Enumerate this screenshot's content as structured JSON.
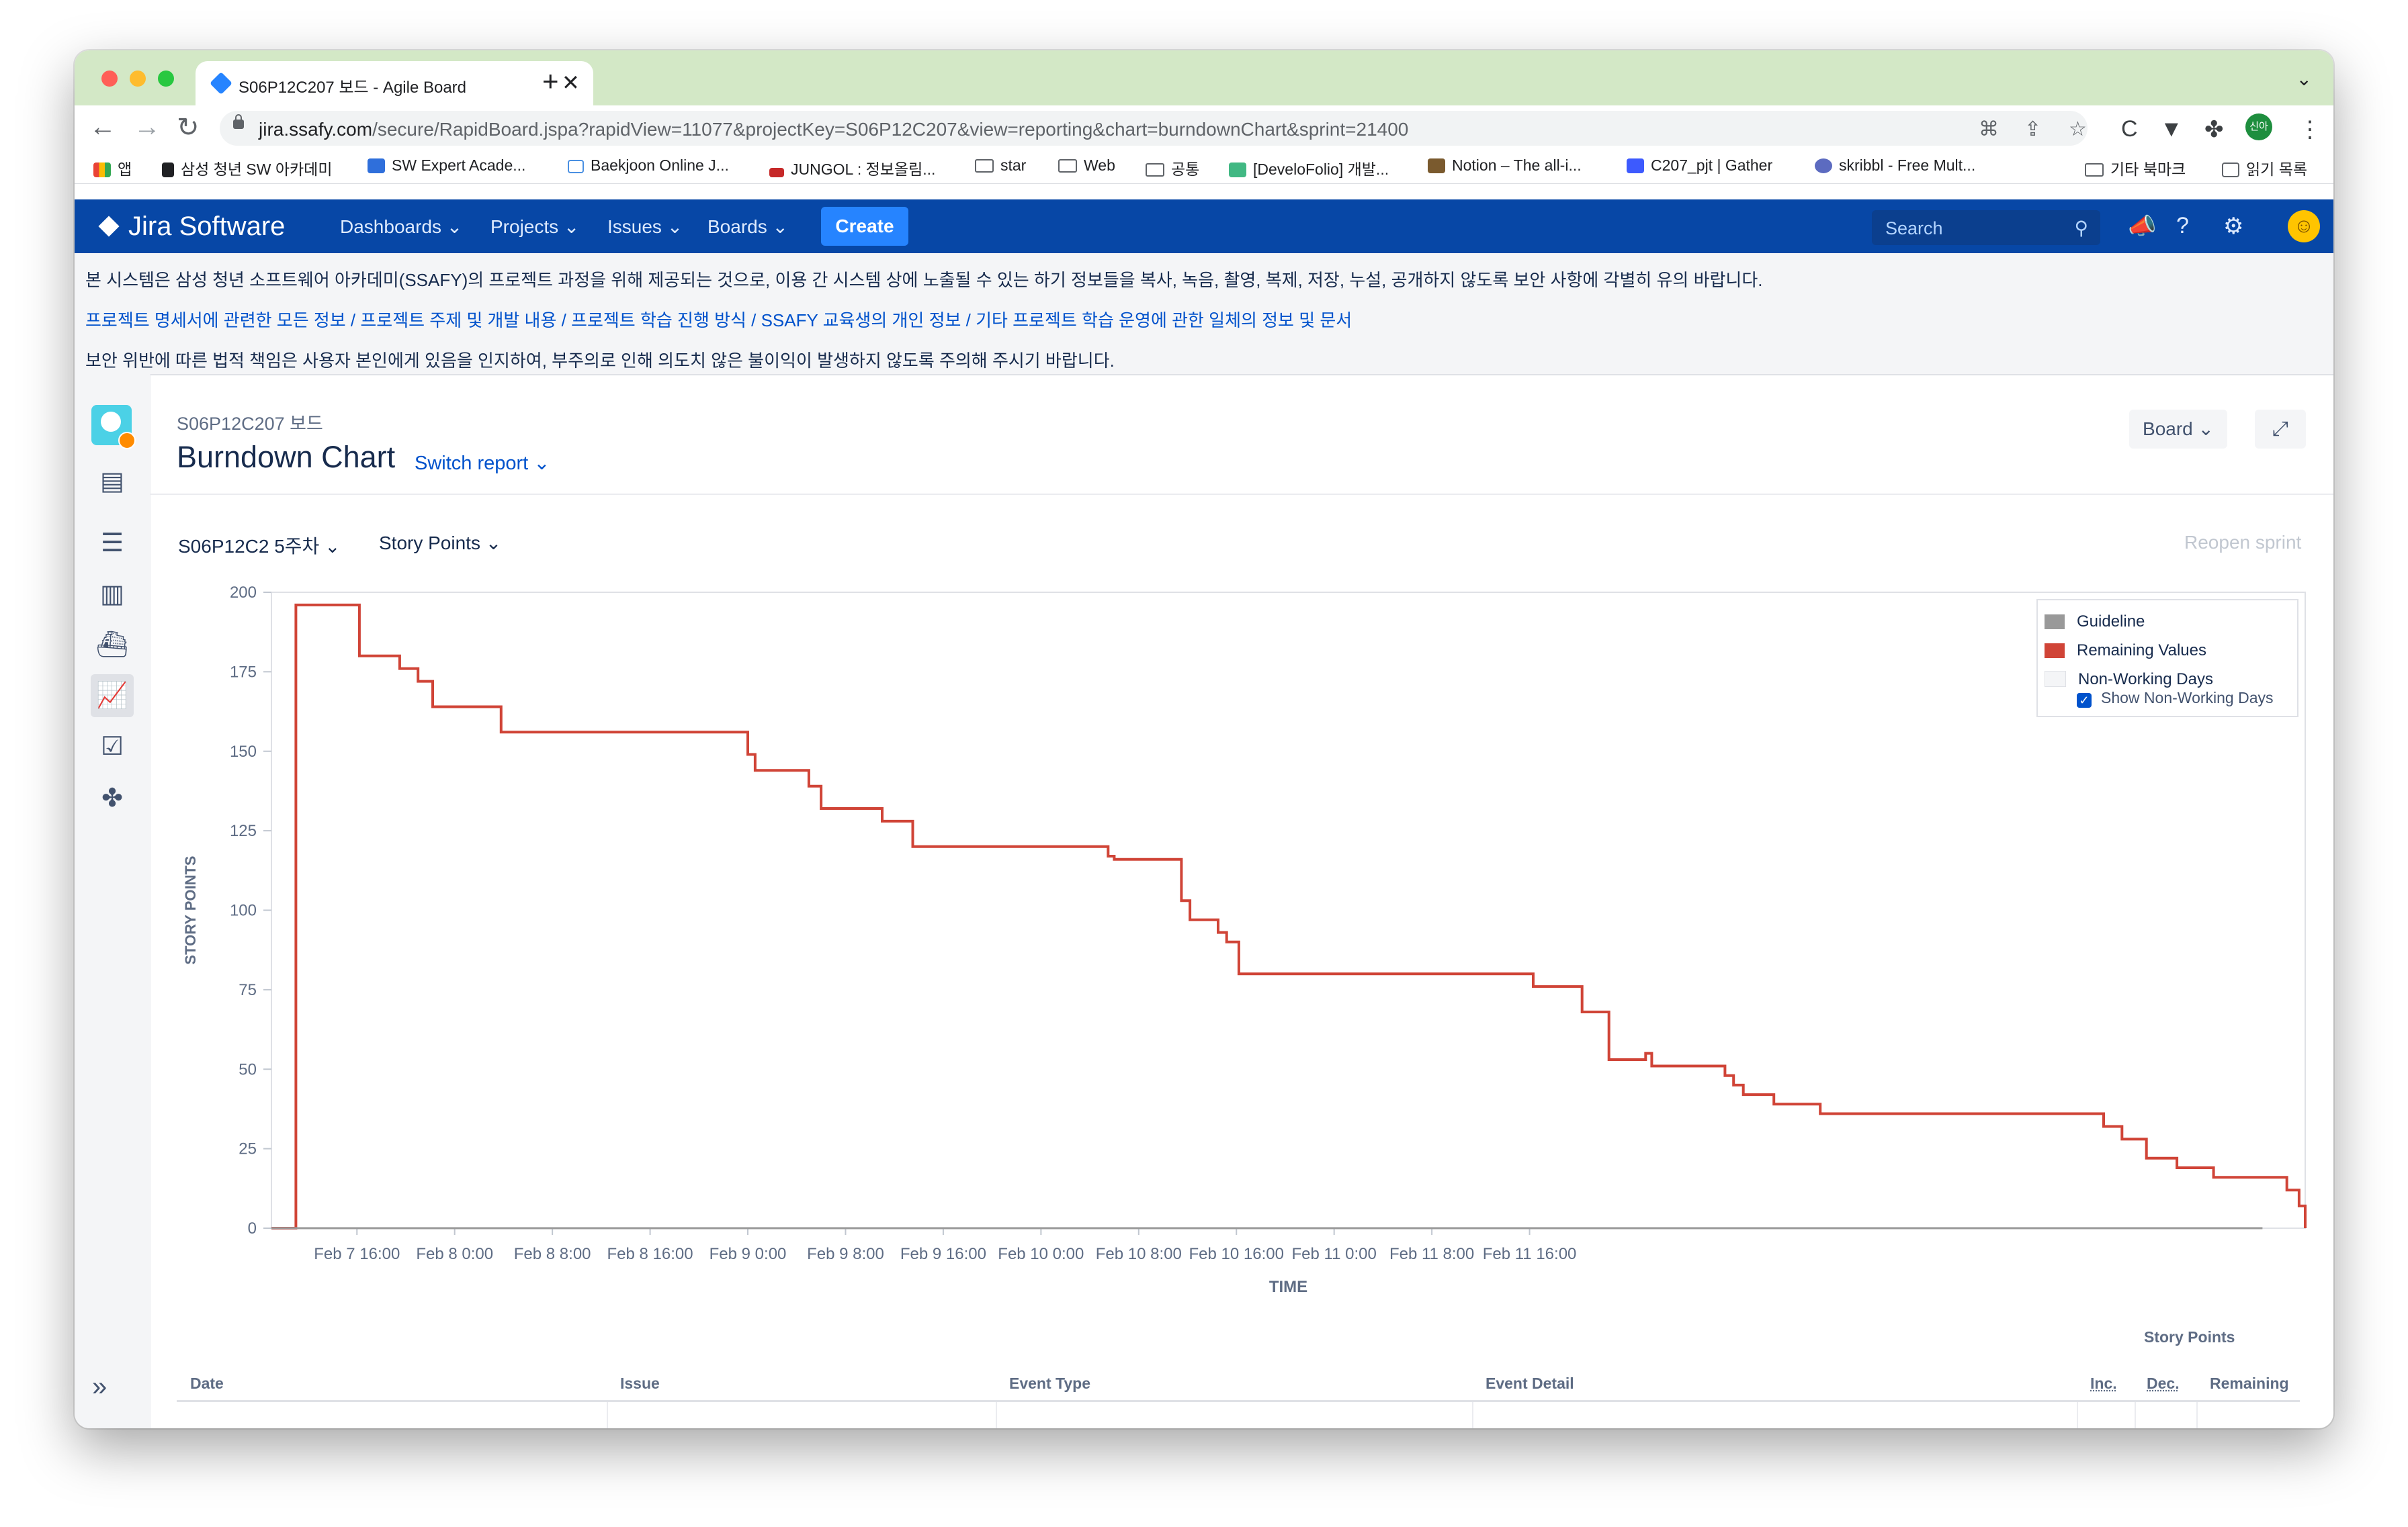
{
  "browser": {
    "tab_title": "S06P12C207 보드 - Agile Board",
    "url_host": "jira.ssafy.com",
    "url_path": "/secure/RapidBoard.jspa?rapidView=11077&projectKey=S06P12C207&view=reporting&chart=burndownChart&sprint=21400",
    "profile_label": "신아",
    "bookmarks": [
      {
        "label": "앱",
        "icon": "apps-grid-icon"
      },
      {
        "label": "삼성 청년 SW 아카데미",
        "icon": "ssafy-icon"
      },
      {
        "label": "SW Expert Acade...",
        "icon": "swea-icon"
      },
      {
        "label": "Baekjoon Online J...",
        "icon": "baekjoon-icon"
      },
      {
        "label": "JUNGOL : 정보올림...",
        "icon": "jungol-icon"
      },
      {
        "label": "star",
        "icon": "folder-icon"
      },
      {
        "label": "Web",
        "icon": "folder-icon"
      },
      {
        "label": "공통",
        "icon": "folder-icon"
      },
      {
        "label": "[DeveloFolio] 개발...",
        "icon": "vue-icon"
      },
      {
        "label": "Notion – The all-i...",
        "icon": "notion-icon"
      },
      {
        "label": "C207_pjt | Gather",
        "icon": "gather-icon"
      },
      {
        "label": "skribbl - Free Mult...",
        "icon": "skribbl-icon"
      },
      {
        "label": "기타 북마크",
        "icon": "folder-icon"
      },
      {
        "label": "읽기 목록",
        "icon": "reading-list-icon"
      }
    ]
  },
  "jira": {
    "logo": "Jira Software",
    "menu": [
      "Dashboards",
      "Projects",
      "Issues",
      "Boards"
    ],
    "create_label": "Create",
    "search_placeholder": "Search"
  },
  "notice": {
    "line1": "본 시스템은 삼성 청년 소프트웨어 아카데미(SSAFY)의 프로젝트 과정을 위해 제공되는 것으로, 이용 간 시스템 상에 노출될 수 있는 하기 정보들을 복사, 녹음, 촬영, 복제, 저장, 누설, 공개하지 않도록 보안 사항에 각별히 유의 바랍니다.",
    "line2": "프로젝트 명세서에 관련한 모든 정보 / 프로젝트 주제 및 개발 내용 / 프로젝트 학습 진행 방식 / SSAFY 교육생의 개인 정보 / 기타 프로젝트 학습 운영에 관한 일체의 정보 및 문서",
    "line3": "보안 위반에 따른 법적 책임은 사용자 본인에게 있음을 인지하여, 부주의로 인해 의도치 않은 불이익이 발생하지 않도록 주의해 주시기 바랍니다."
  },
  "page": {
    "breadcrumb": "S06P12C207 보드",
    "title": "Burndown Chart",
    "switch_report": "Switch report",
    "board_button": "Board",
    "sprint_select": "S06P12C2 5주차",
    "estimation_select": "Story Points",
    "reopen_sprint": "Reopen sprint"
  },
  "legend": {
    "guideline": "Guideline",
    "remaining": "Remaining Values",
    "non_working": "Non-Working Days",
    "show_non_working": "Show Non-Working Days",
    "show_non_working_checked": true
  },
  "table": {
    "group_header": "Story Points",
    "headers": [
      "Date",
      "Issue",
      "Event Type",
      "Event Detail",
      "Inc.",
      "Dec.",
      "Remaining"
    ]
  },
  "colors": {
    "jira_nav": "#0747a6",
    "create_button": "#2684ff",
    "remaining_line": "#d04437",
    "guideline": "#999999",
    "link": "#0052cc"
  },
  "chart_data": {
    "type": "line",
    "title": "",
    "xlabel": "TIME",
    "ylabel": "STORY POINTS",
    "ylim": [
      0,
      200
    ],
    "yticks": [
      0,
      25,
      50,
      75,
      100,
      125,
      150,
      175,
      200
    ],
    "xticks": [
      "Feb 7 16:00",
      "Feb 8 0:00",
      "Feb 8 8:00",
      "Feb 8 16:00",
      "Feb 9 0:00",
      "Feb 9 8:00",
      "Feb 9 16:00",
      "Feb 10 0:00",
      "Feb 10 8:00",
      "Feb 10 16:00",
      "Feb 11 0:00",
      "Feb 11 8:00",
      "Feb 11 16:00"
    ],
    "xlim_hours": [
      -7,
      159.5
    ],
    "x_unit": "hours since Feb 7 16:00",
    "series": [
      {
        "name": "Remaining Values",
        "step": true,
        "points": [
          [
            -7,
            0
          ],
          [
            -5,
            0
          ],
          [
            -5,
            196
          ],
          [
            0.2,
            196
          ],
          [
            0.2,
            180
          ],
          [
            3.5,
            180
          ],
          [
            3.5,
            176
          ],
          [
            5,
            176
          ],
          [
            5,
            172
          ],
          [
            6.2,
            172
          ],
          [
            6.2,
            164
          ],
          [
            11.8,
            164
          ],
          [
            11.8,
            156
          ],
          [
            32,
            156
          ],
          [
            32,
            149
          ],
          [
            32.6,
            149
          ],
          [
            32.6,
            144
          ],
          [
            37,
            144
          ],
          [
            37,
            139
          ],
          [
            38,
            139
          ],
          [
            38,
            132
          ],
          [
            43,
            132
          ],
          [
            43,
            128
          ],
          [
            45.5,
            128
          ],
          [
            45.5,
            120
          ],
          [
            61.5,
            120
          ],
          [
            61.5,
            117
          ],
          [
            62,
            117
          ],
          [
            62,
            116
          ],
          [
            67.5,
            116
          ],
          [
            67.5,
            103
          ],
          [
            68.2,
            103
          ],
          [
            68.2,
            97
          ],
          [
            70.5,
            97
          ],
          [
            70.5,
            93
          ],
          [
            71.2,
            93
          ],
          [
            71.2,
            90
          ],
          [
            72.2,
            90
          ],
          [
            72.2,
            80
          ],
          [
            96.3,
            80
          ],
          [
            96.3,
            76
          ],
          [
            100.3,
            76
          ],
          [
            100.3,
            68
          ],
          [
            102.5,
            68
          ],
          [
            102.5,
            53
          ],
          [
            105.5,
            53
          ],
          [
            105.5,
            55
          ],
          [
            106,
            55
          ],
          [
            106,
            51
          ],
          [
            112,
            51
          ],
          [
            112,
            48
          ],
          [
            112.7,
            48
          ],
          [
            112.7,
            45
          ],
          [
            113.5,
            45
          ],
          [
            113.5,
            42
          ],
          [
            116,
            42
          ],
          [
            116,
            39
          ],
          [
            119.8,
            39
          ],
          [
            119.8,
            36
          ],
          [
            143,
            36
          ],
          [
            143,
            32
          ],
          [
            144.5,
            32
          ],
          [
            144.5,
            28
          ],
          [
            146.5,
            28
          ],
          [
            146.5,
            22
          ],
          [
            149,
            22
          ],
          [
            149,
            19
          ],
          [
            152,
            19
          ],
          [
            152,
            16
          ],
          [
            158,
            16
          ],
          [
            158,
            12
          ],
          [
            159,
            12
          ],
          [
            159,
            7
          ],
          [
            159.5,
            7
          ],
          [
            159.5,
            0
          ]
        ]
      },
      {
        "name": "Guideline",
        "points": [
          [
            -7,
            0
          ],
          [
            156,
            0
          ]
        ]
      }
    ],
    "grid": false,
    "legend_position": "top-right"
  }
}
